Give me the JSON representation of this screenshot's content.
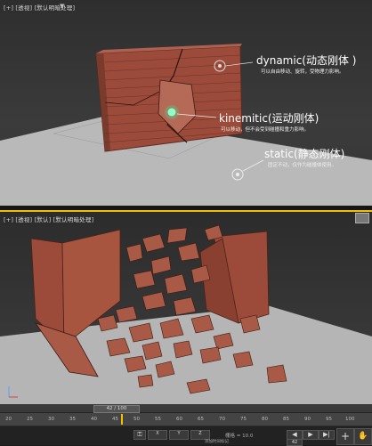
{
  "top_viewport": {
    "label": "[+] [透视] [默认明暗处理]",
    "filter_icon": "filter-icon"
  },
  "annotations": {
    "dynamic": {
      "title": "dynamic(动态刚体 )",
      "desc": "可以自由移动、旋转，受物理力影响。"
    },
    "kinematic": {
      "title": "kinemitic(运动刚体)",
      "desc": "可以移动，但不会受到碰撞和重力影响。"
    },
    "static": {
      "title": "static(静态刚体)",
      "desc": "固定不动，仅作为碰撞体使用。"
    }
  },
  "bottom_viewport": {
    "label": "[+] [透视] [默认] [默认明暗处理]"
  },
  "timeline": {
    "frame_display": "42 / 100",
    "ticks": [
      "20",
      "25",
      "30",
      "35",
      "40",
      "45",
      "50",
      "55",
      "60",
      "65",
      "70",
      "75",
      "80",
      "85",
      "90",
      "95",
      "100"
    ]
  },
  "status": {
    "grid": "栅格 = 10.0",
    "add_time_tag": "添加时间标记",
    "frame_field": "42"
  },
  "colors": {
    "accent": "#f0c000",
    "brick": "#9a4a38"
  }
}
